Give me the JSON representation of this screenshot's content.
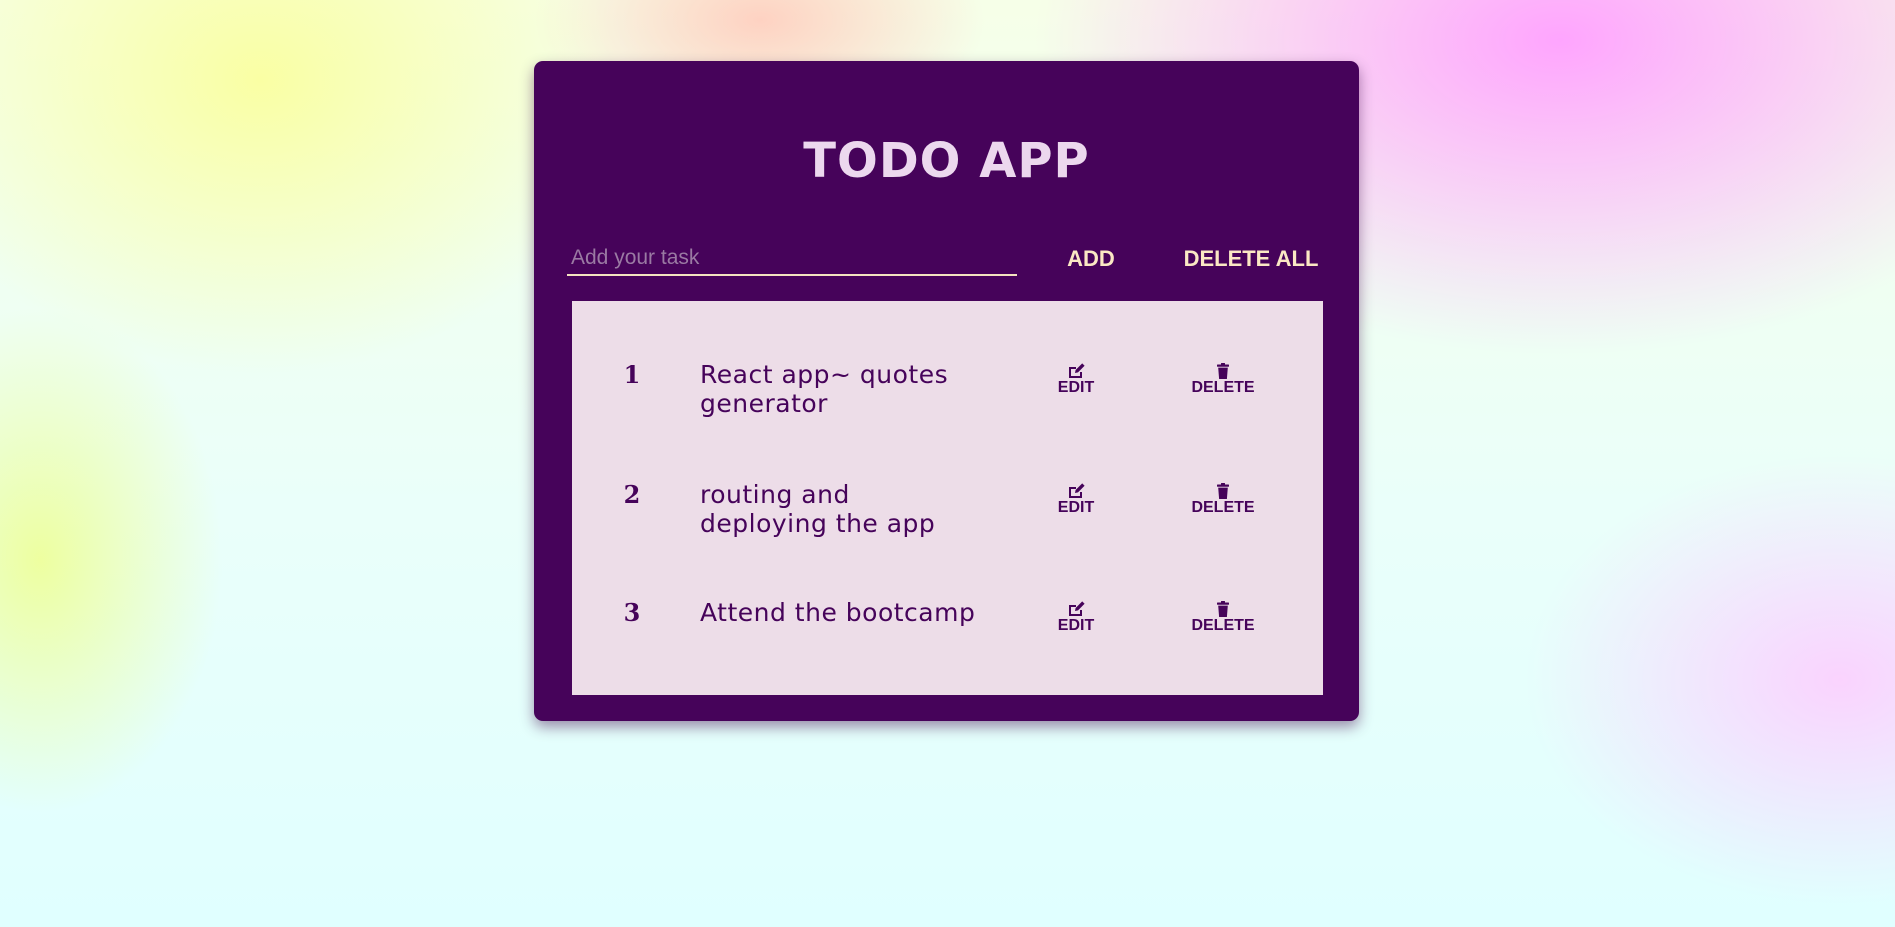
{
  "app": {
    "title": "TODO APP"
  },
  "input": {
    "placeholder": "Add your task",
    "value": ""
  },
  "buttons": {
    "add_label": "ADD",
    "delete_all_label": "DELETE ALL"
  },
  "tasks": [
    {
      "number": "1",
      "text": "React app~ quotes generator",
      "edit_label": "EDIT",
      "delete_label": "DELETE"
    },
    {
      "number": "2",
      "text": "routing and deploying the app",
      "edit_label": "EDIT",
      "delete_label": "DELETE"
    },
    {
      "number": "3",
      "text": "Attend the bootcamp",
      "edit_label": "EDIT",
      "delete_label": "DELETE"
    }
  ],
  "icons": {
    "edit": "edit-icon",
    "delete": "trash-icon"
  },
  "colors": {
    "card_background": "#46035a",
    "list_background": "#eddde8",
    "title_text": "#ecd8ee",
    "button_text": "#fbe8c4",
    "task_text": "#46035a"
  }
}
